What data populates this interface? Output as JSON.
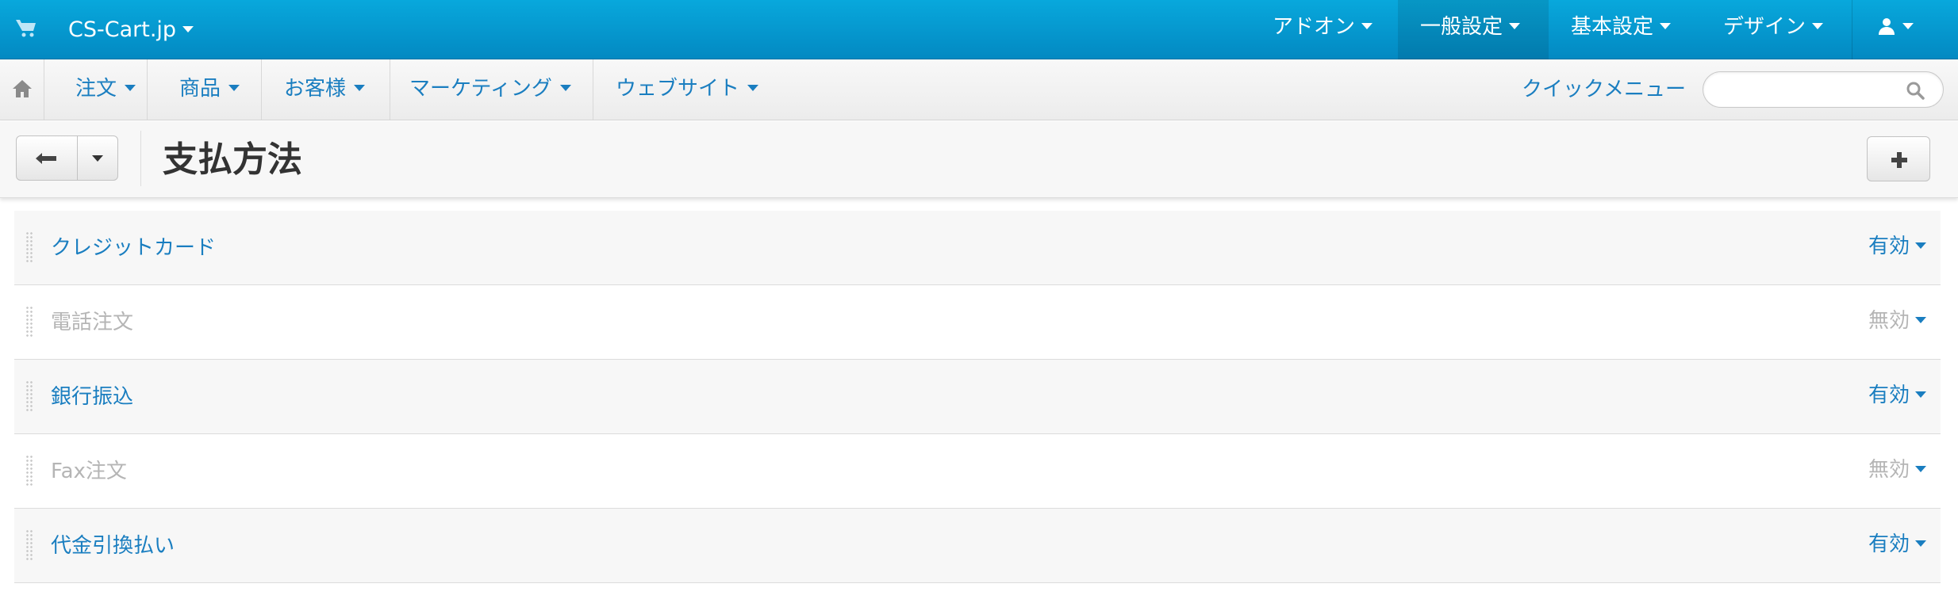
{
  "topbar": {
    "brand": "CS-Cart.jp",
    "menus": [
      {
        "label": "アドオン"
      },
      {
        "label": "一般設定"
      },
      {
        "label": "基本設定"
      },
      {
        "label": "デザイン"
      }
    ],
    "user_icon": "user-icon"
  },
  "navbar": {
    "home_icon": "home-icon",
    "items": [
      {
        "label": "注文"
      },
      {
        "label": "商品"
      },
      {
        "label": "お客様"
      },
      {
        "label": "マーケティング"
      },
      {
        "label": "ウェブサイト"
      }
    ],
    "quick_menu_label": "クイックメニュー",
    "search": {
      "value": "",
      "placeholder": ""
    }
  },
  "titlebar": {
    "title": "支払方法",
    "back_icon": "back-arrow-icon",
    "add_icon": "plus-icon"
  },
  "payment_methods": [
    {
      "name": "クレジットカード",
      "status": "有効",
      "enabled": true
    },
    {
      "name": "電話注文",
      "status": "無効",
      "enabled": false
    },
    {
      "name": "銀行振込",
      "status": "有効",
      "enabled": true
    },
    {
      "name": "Fax注文",
      "status": "無効",
      "enabled": false
    },
    {
      "name": "代金引換払い",
      "status": "有効",
      "enabled": true
    }
  ],
  "colors": {
    "topbar": "#0596d0",
    "link": "#1a7ec0",
    "disabled": "#b5b5b5"
  }
}
